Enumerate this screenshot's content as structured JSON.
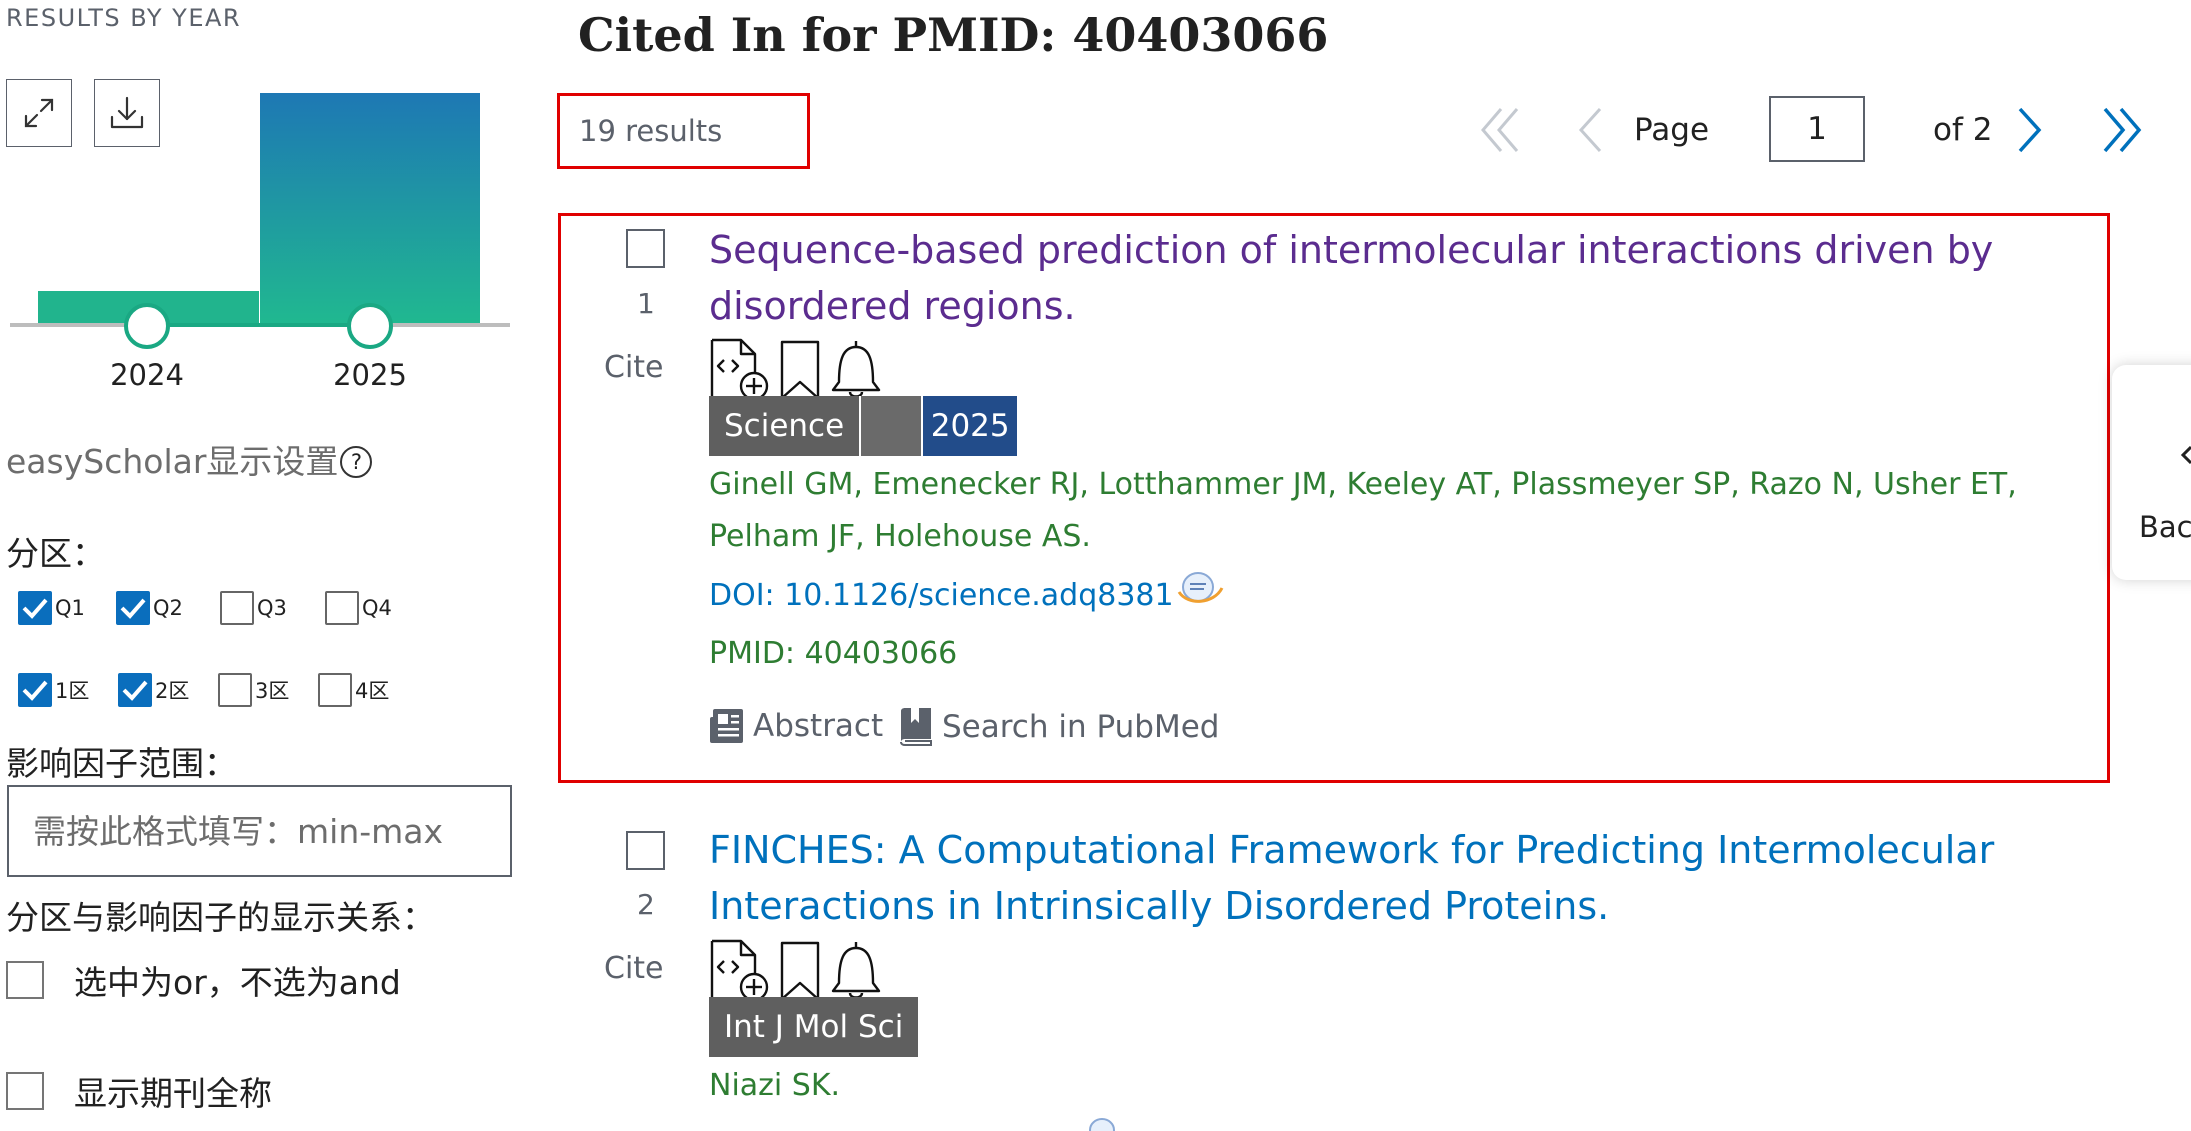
{
  "sidebar": {
    "results_by_year_label": "RESULTS BY YEAR",
    "expand_icon": "expand-icon",
    "download_icon": "download-icon",
    "year_chart": {
      "years": [
        "2024",
        "2025"
      ],
      "counts_relative": [
        0.13,
        1.0
      ],
      "gradient_top": "#1e78b4",
      "gradient_bottom": "#20b890"
    },
    "easyscholar": {
      "title": "easyScholar显示设置",
      "help_glyph": "?",
      "partition_label": "分区：",
      "partitions_row1": [
        {
          "label": "Q1",
          "checked": true
        },
        {
          "label": "Q2",
          "checked": true
        },
        {
          "label": "Q3",
          "checked": false
        },
        {
          "label": "Q4",
          "checked": false
        }
      ],
      "partitions_row2": [
        {
          "label": "1区",
          "checked": true
        },
        {
          "label": "2区",
          "checked": true
        },
        {
          "label": "3区",
          "checked": false
        },
        {
          "label": "4区",
          "checked": false
        }
      ],
      "if_range_label": "影响因子范围：",
      "if_range_placeholder": "需按此格式填写：min-max",
      "relation_label": "分区与影响因子的显示关系：",
      "option_or_and": "选中为or，不选为and",
      "option_full_name": "显示期刊全称"
    }
  },
  "main": {
    "title": "Cited In for PMID: 40403066",
    "results_count": "19 results",
    "pager": {
      "page_label": "Page",
      "page_value": "1",
      "of_label": "of 2"
    },
    "results": [
      {
        "number": "1",
        "cite_label": "Cite",
        "title": "Sequence-based prediction of intermolecular interactions driven by disordered regions.",
        "journal": "Science",
        "year": "2025",
        "authors": "Ginell GM, Emenecker RJ, Lotthammer JM, Keeley AT, Plassmeyer SP, Razo N, Usher ET, Pelham JF, Holehouse AS.",
        "doi": "DOI: 10.1126/science.adq8381",
        "pmid": "PMID: 40403066",
        "abstract_label": "Abstract",
        "search_pubmed_label": "Search in PubMed"
      },
      {
        "number": "2",
        "cite_label": "Cite",
        "title": "FINCHES: A Computational Framework for Predicting Intermolecular Interactions in Intrinsically Disordered Proteins.",
        "journal": "Int J Mol Sci",
        "authors": "Niazi SK."
      }
    ],
    "back_label": "Back"
  },
  "colors": {
    "highlight_red": "#e00000",
    "visited_link": "#5b2c8f",
    "link_blue": "#0071bc",
    "author_green": "#2e7d32",
    "year_badge": "#224c8a",
    "checkbox_blue": "#0a6ebd"
  }
}
